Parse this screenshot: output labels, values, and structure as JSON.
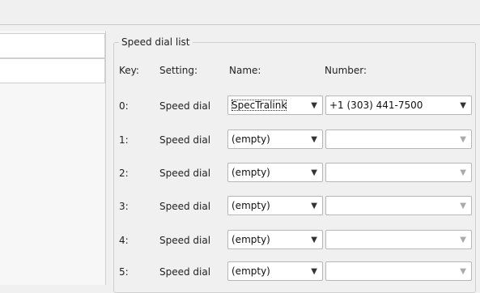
{
  "group_title": "Speed dial list",
  "headers": {
    "key": "Key:",
    "setting": "Setting:",
    "name": "Name:",
    "number": "Number:"
  },
  "arrow": "▼",
  "rows": [
    {
      "key": "0:",
      "setting": "Speed dial",
      "name": "SpecTralink",
      "number": "+1 (303) 441-7500"
    },
    {
      "key": "1:",
      "setting": "Speed dial",
      "name": "(empty)",
      "number": ""
    },
    {
      "key": "2:",
      "setting": "Speed dial",
      "name": "(empty)",
      "number": ""
    },
    {
      "key": "3:",
      "setting": "Speed dial",
      "name": "(empty)",
      "number": ""
    },
    {
      "key": "4:",
      "setting": "Speed dial",
      "name": "(empty)",
      "number": ""
    },
    {
      "key": "5:",
      "setting": "Speed dial",
      "name": "(empty)",
      "number": ""
    }
  ]
}
